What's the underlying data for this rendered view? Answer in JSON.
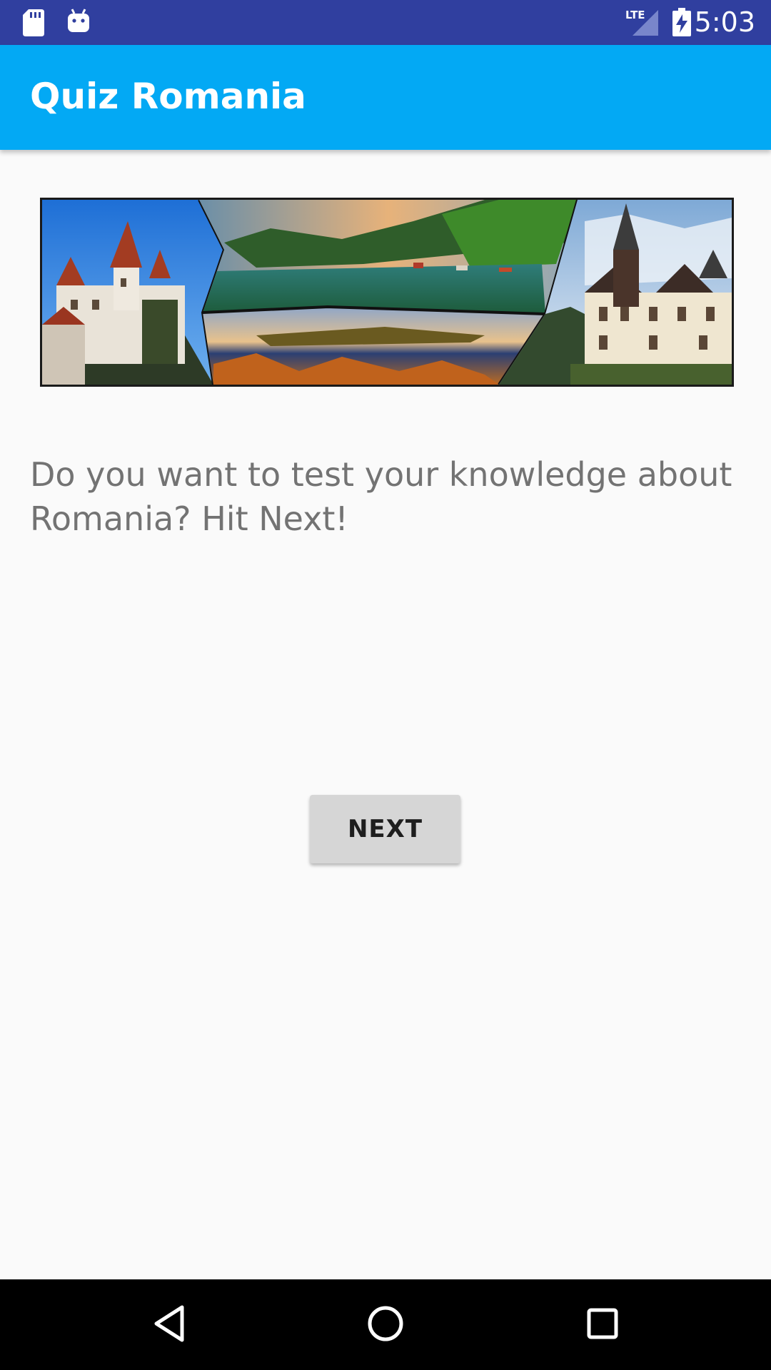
{
  "status_bar": {
    "time": "5:03",
    "network": "LTE",
    "icons": [
      "sd-card-icon",
      "android-icon",
      "lte-signal-icon",
      "battery-charging-icon"
    ],
    "background_color": "#303f9f"
  },
  "app_bar": {
    "title": "Quiz Romania",
    "background_color": "#03a9f4"
  },
  "banner": {
    "description_icon": "romania-landmarks-collage-image"
  },
  "main": {
    "intro_text": "Do you want to test your knowledge about Romania? Hit Next!",
    "next_button_label": "NEXT"
  },
  "nav_bar": {
    "icons": [
      "back-icon",
      "home-icon",
      "recents-icon"
    ]
  }
}
